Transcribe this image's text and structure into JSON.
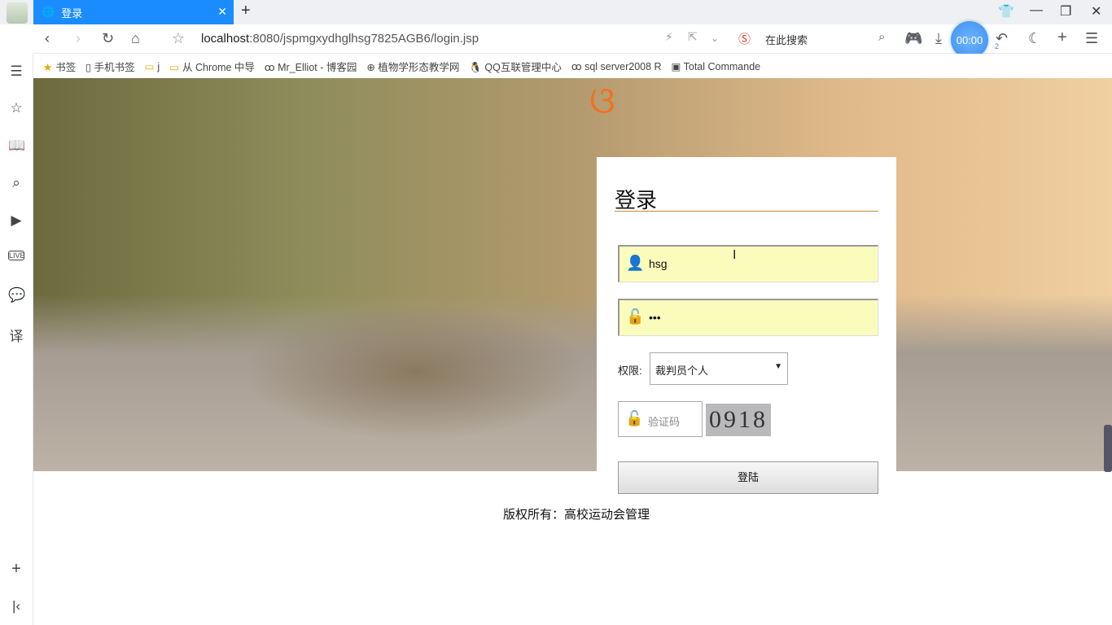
{
  "browser": {
    "tab_title": "登录",
    "url_host": "localhost",
    "url_rest": ":8080/jspmgxydhglhsg7825AGB6/login.jsp",
    "search_placeholder": "在此搜索",
    "timer": "00:00",
    "undo_count": "2",
    "bookmarks": [
      "书签",
      "手机书签",
      "j",
      "从 Chrome 中导",
      "Mr_Elliot - 博客园",
      "植物学形态教学网",
      "QQ互联管理中心",
      "sql server2008 R",
      "Total Commande"
    ]
  },
  "login": {
    "title": "登录",
    "username": "hsg",
    "password_mask": "•••",
    "role_label": "权限:",
    "role_selected": "裁判员个人",
    "captcha_placeholder": "验证码",
    "captcha_code": "0918",
    "submit": "登陆"
  },
  "footer": {
    "text": "版权所有：高校运动会管理"
  },
  "colors": {
    "tab": "#1a8cff",
    "input_bg": "#fafcbb",
    "title_rule": "#c98a3a"
  }
}
